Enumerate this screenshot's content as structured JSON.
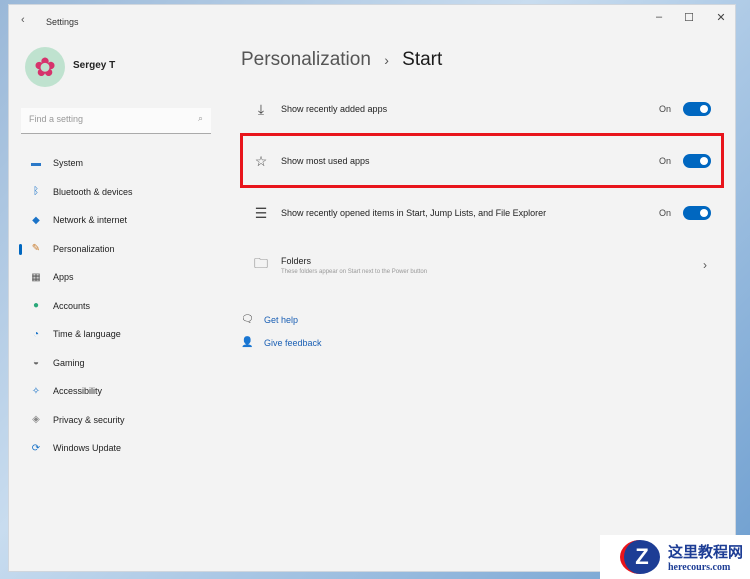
{
  "window": {
    "title": "Settings"
  },
  "user": {
    "name": "Sergey T"
  },
  "search": {
    "placeholder": "Find a setting"
  },
  "nav": [
    {
      "label": "System",
      "icon": "monitor-icon"
    },
    {
      "label": "Bluetooth & devices",
      "icon": "bluetooth-icon"
    },
    {
      "label": "Network & internet",
      "icon": "wifi-icon"
    },
    {
      "label": "Personalization",
      "icon": "brush-icon"
    },
    {
      "label": "Apps",
      "icon": "apps-icon"
    },
    {
      "label": "Accounts",
      "icon": "person-icon"
    },
    {
      "label": "Time & language",
      "icon": "globe-clock-icon"
    },
    {
      "label": "Gaming",
      "icon": "gamepad-icon"
    },
    {
      "label": "Accessibility",
      "icon": "accessibility-icon"
    },
    {
      "label": "Privacy & security",
      "icon": "shield-icon"
    },
    {
      "label": "Windows Update",
      "icon": "update-icon"
    }
  ],
  "breadcrumb": {
    "parent": "Personalization",
    "sep": "›",
    "current": "Start"
  },
  "settings": [
    {
      "label": "Show recently added apps",
      "state": "On"
    },
    {
      "label": "Show most used apps",
      "state": "On"
    },
    {
      "label": "Show recently opened items in Start, Jump Lists, and File Explorer",
      "state": "On"
    }
  ],
  "folders": {
    "label": "Folders",
    "desc": "These folders appear on Start next to the Power button"
  },
  "links": {
    "help": "Get help",
    "feedback": "Give feedback"
  },
  "watermark": {
    "cn": "这里教程网",
    "url": "herecours.com"
  },
  "colors": {
    "accent": "#0067c0",
    "highlight": "#e8141b"
  }
}
